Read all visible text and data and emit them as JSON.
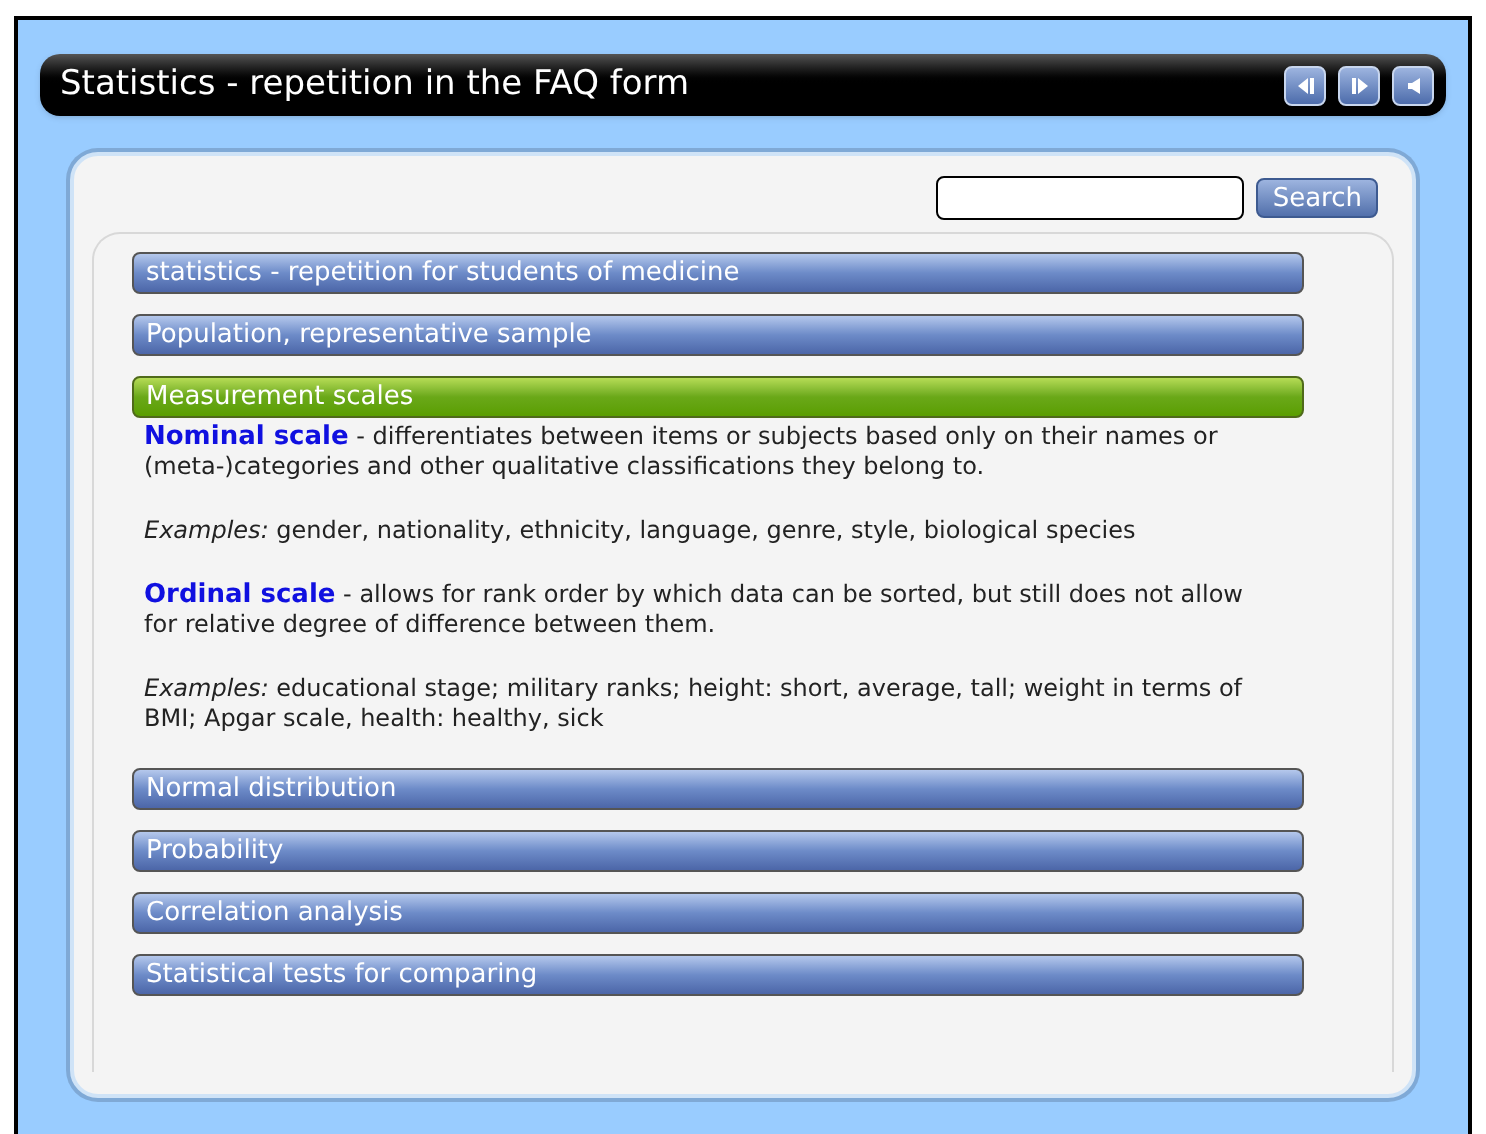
{
  "window": {
    "title": "Statistics - repetition in the FAQ form"
  },
  "nav_buttons": [
    {
      "kind": "previous"
    },
    {
      "kind": "next"
    },
    {
      "kind": "sound"
    }
  ],
  "search": {
    "button": "Search"
  },
  "faq": [
    {
      "label": "statistics - repetition for students of medicine",
      "expanded": false
    },
    {
      "label": "Population, representative sample",
      "expanded": false
    },
    {
      "label": "Measurement scales",
      "expanded": true,
      "paragraphs": [
        "**Nominal scale** - differentiates between items or subjects based only on their names or (meta-)categories and other qualitative classifications they belong to.",
        "*Examples:* gender, nationality, ethnicity, language, genre, style, biological species",
        "**Ordinal scale** - allows for rank order by which data can be sorted, but still does not allow for relative degree of difference between them.",
        "*Examples:* educational stage; military ranks; height: short, average, tall; weight in terms of BMI; Apgar scale, health: healthy, sick"
      ]
    },
    {
      "label": "Normal distribution",
      "expanded": false
    },
    {
      "label": "Probability",
      "expanded": false
    },
    {
      "label": "Correlation analysis",
      "expanded": false
    },
    {
      "label": "Statistical tests for comparing",
      "expanded": false
    }
  ]
}
